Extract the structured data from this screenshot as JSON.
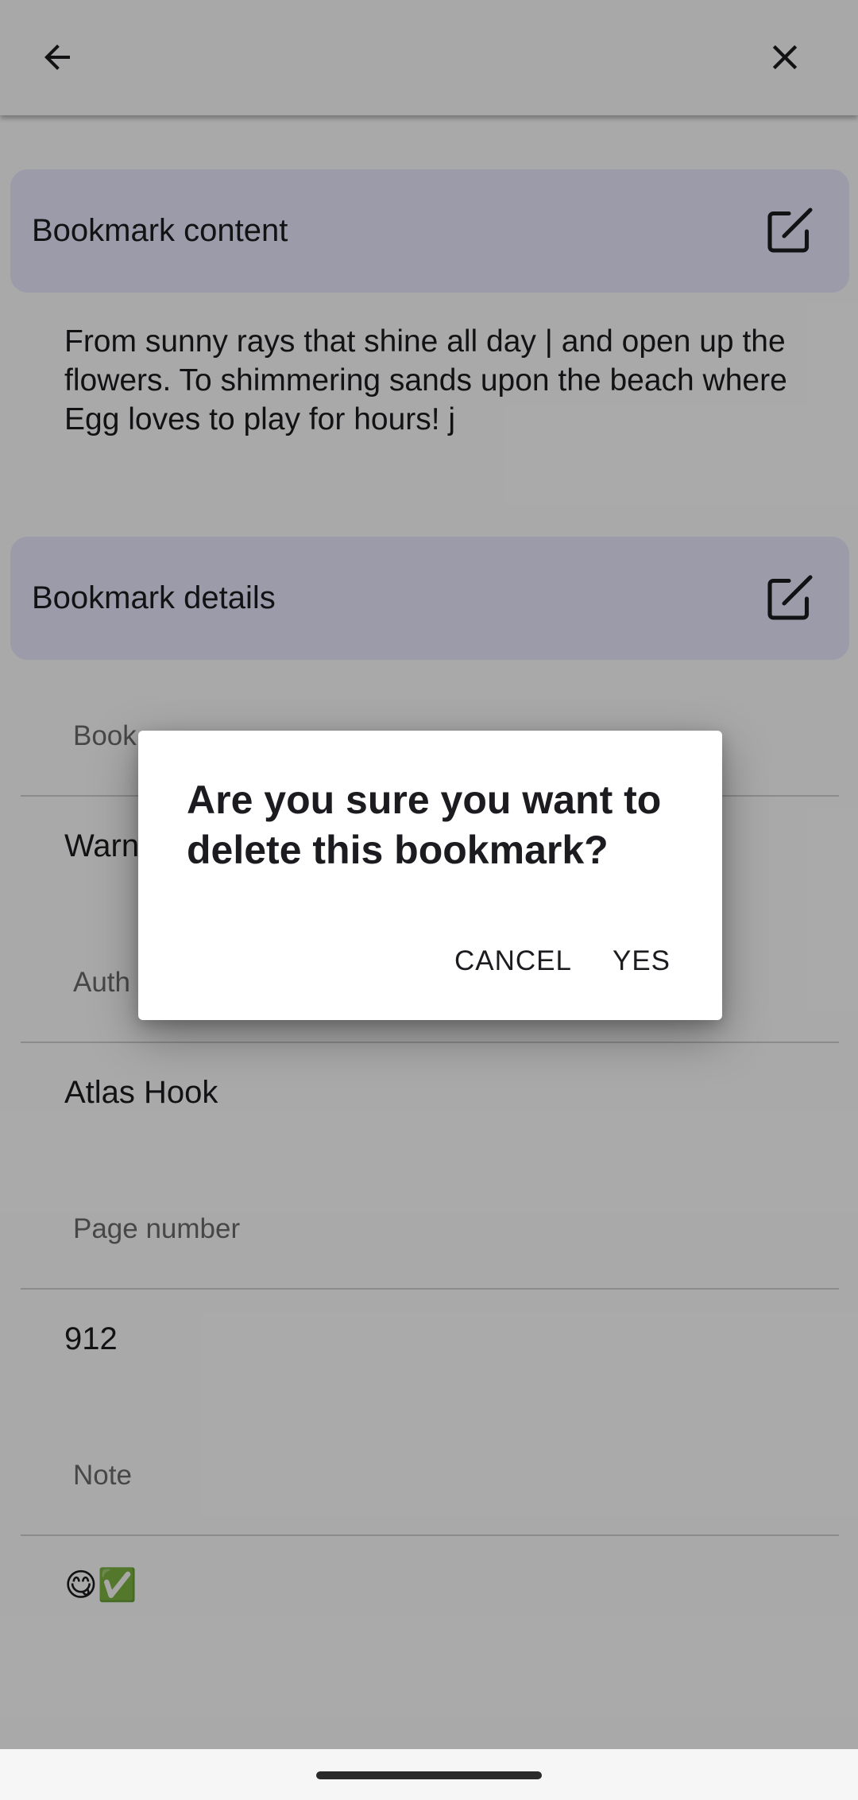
{
  "app_bar": {
    "back_icon": "arrow-back-icon",
    "close_icon": "close-icon"
  },
  "content_section": {
    "title": "Bookmark content",
    "edit_icon": "edit-square-icon",
    "text": "From sunny rays that shine all day | and open up the flowers. To shimmering sands upon the beach where Egg loves to play for hours! j"
  },
  "details_section": {
    "title": "Bookmark details",
    "edit_icon": "edit-square-icon",
    "fields": {
      "book": {
        "label": "Book",
        "value": "Warn"
      },
      "author": {
        "label": "Auth",
        "value": "Atlas Hook"
      },
      "page": {
        "label": "Page number",
        "value": "912"
      },
      "note": {
        "label": "Note",
        "value": "😋✅"
      }
    }
  },
  "dialog": {
    "title": "Are you sure you want to delete this bookmark?",
    "cancel_label": "CANCEL",
    "yes_label": "YES"
  },
  "colors": {
    "section_header_bg": "#e8e7fe",
    "scrim": "rgba(0,0,0,0.33)",
    "dialog_bg": "#ffffff"
  }
}
